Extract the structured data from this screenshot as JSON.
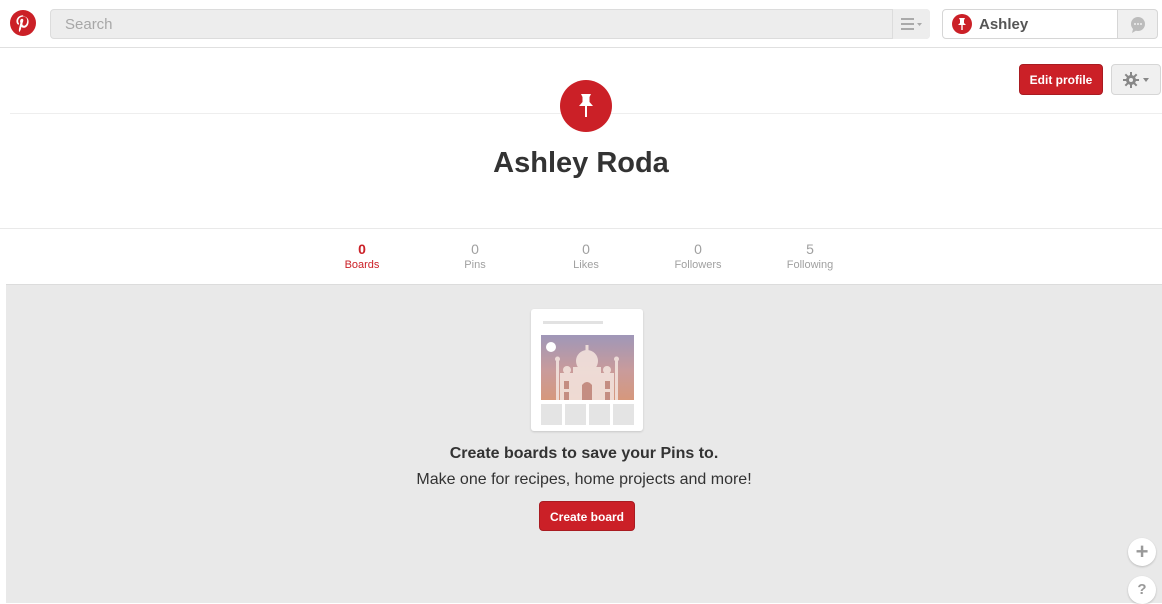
{
  "header": {
    "search": {
      "placeholder": "Search",
      "value": ""
    },
    "user": {
      "name": "Ashley"
    }
  },
  "profile": {
    "name": "Ashley Roda",
    "edit_label": "Edit profile"
  },
  "stats": [
    {
      "count": "0",
      "label": "Boards",
      "active": true
    },
    {
      "count": "0",
      "label": "Pins",
      "active": false
    },
    {
      "count": "0",
      "label": "Likes",
      "active": false
    },
    {
      "count": "0",
      "label": "Followers",
      "active": false
    },
    {
      "count": "5",
      "label": "Following",
      "active": false
    }
  ],
  "empty_state": {
    "title": "Create boards to save your Pins to.",
    "subtitle": "Make one for recipes, home projects and more!",
    "button_label": "Create board"
  },
  "icons": {
    "logo": "pinterest-logo-icon",
    "menu": "menu-lines-icon",
    "avatar": "pushpin-icon",
    "messages": "speech-bubble-icon",
    "settings": "gear-icon",
    "add": "plus-icon",
    "help": "question-icon"
  },
  "colors": {
    "brand_red": "#cb2027",
    "background_gray": "#e9e9e9"
  }
}
